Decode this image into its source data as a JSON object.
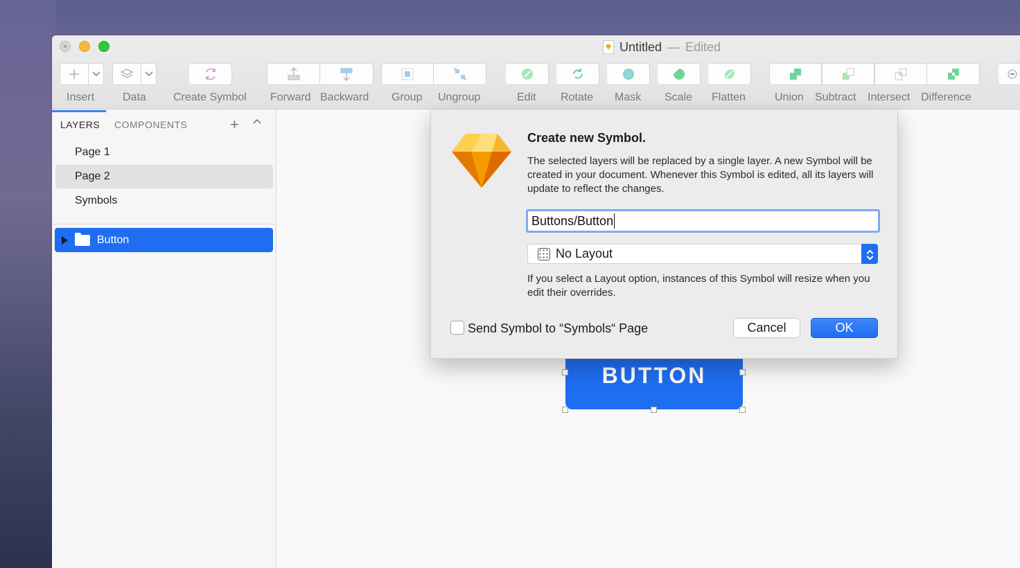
{
  "window": {
    "title": "Untitled",
    "title_separator": "—",
    "status": "Edited"
  },
  "toolbar": {
    "insert": "Insert",
    "data": "Data",
    "create_symbol": "Create Symbol",
    "forward": "Forward",
    "backward": "Backward",
    "group": "Group",
    "ungroup": "Ungroup",
    "edit": "Edit",
    "rotate": "Rotate",
    "mask": "Mask",
    "scale": "Scale",
    "flatten": "Flatten",
    "union": "Union",
    "subtract": "Subtract",
    "intersect": "Intersect",
    "difference": "Difference",
    "boolean_color": "#4cd3a0"
  },
  "sidebar": {
    "tab_layers": "LAYERS",
    "tab_components": "COMPONENTS",
    "pages": [
      {
        "label": "Page 1"
      },
      {
        "label": "Page 2"
      },
      {
        "label": "Symbols"
      }
    ],
    "selected_page": "Page 2",
    "layers": [
      {
        "label": "Button"
      }
    ]
  },
  "canvas": {
    "artboard_button_label": "BUTTON",
    "accent": "#1f6ef2"
  },
  "dialog": {
    "title": "Create new Symbol.",
    "body": "The selected layers will be replaced by a single layer. A new Symbol will be created in your document. Whenever this Symbol is edited, all its layers will update to reflect the changes.",
    "name_value": "Buttons/Button",
    "layout_selected": "No Layout",
    "layout_help": "If you select a Layout option, instances of this Symbol will resize when you edit their overrides.",
    "checkbox_label": "Send Symbol to “Symbols“ Page",
    "checkbox_checked": false,
    "cancel_label": "Cancel",
    "ok_label": "OK"
  }
}
